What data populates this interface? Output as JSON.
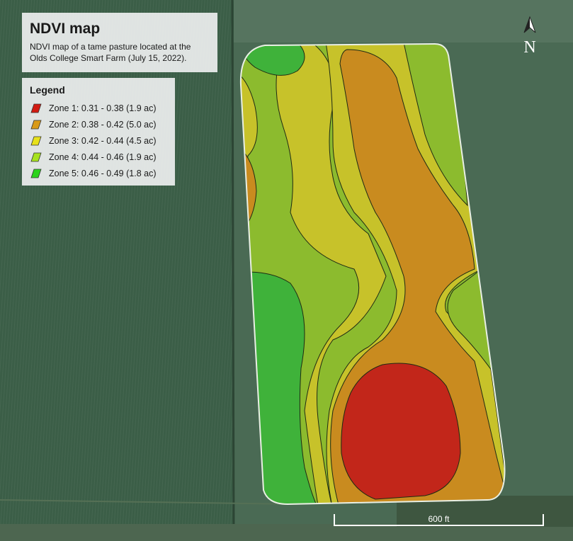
{
  "title": "NDVI map",
  "subtitle_line1": "NDVI map of a tame pasture located at the",
  "subtitle_line2": "Olds College Smart Farm (July 15, 2022).",
  "legend": {
    "title": "Legend",
    "items": [
      {
        "label": "Zone 1: 0.31 - 0.38 (1.9 ac)",
        "color": "#d21b12"
      },
      {
        "label": "Zone 2: 0.38 - 0.42 (5.0 ac)",
        "color": "#d99a18"
      },
      {
        "label": "Zone 3: 0.42 - 0.44 (4.5 ac)",
        "color": "#e7e11a"
      },
      {
        "label": "Zone 4: 0.44 - 0.46 (1.9 ac)",
        "color": "#a7e21e"
      },
      {
        "label": "Zone 5: 0.46 - 0.49 (1.8 ac)",
        "color": "#2bd41b"
      }
    ]
  },
  "north_label": "N",
  "scale_label": "600 ft",
  "colors": {
    "field_dark": "#365a44",
    "field_light": "#5d7a5a",
    "zone1": "#c2261a",
    "zone2": "#c98b1f",
    "zone3": "#c7c22a",
    "zone4": "#8cbb2e",
    "zone5": "#3fb23a"
  },
  "icons": [
    "north-arrow-icon",
    "zone-swatch-icon"
  ]
}
